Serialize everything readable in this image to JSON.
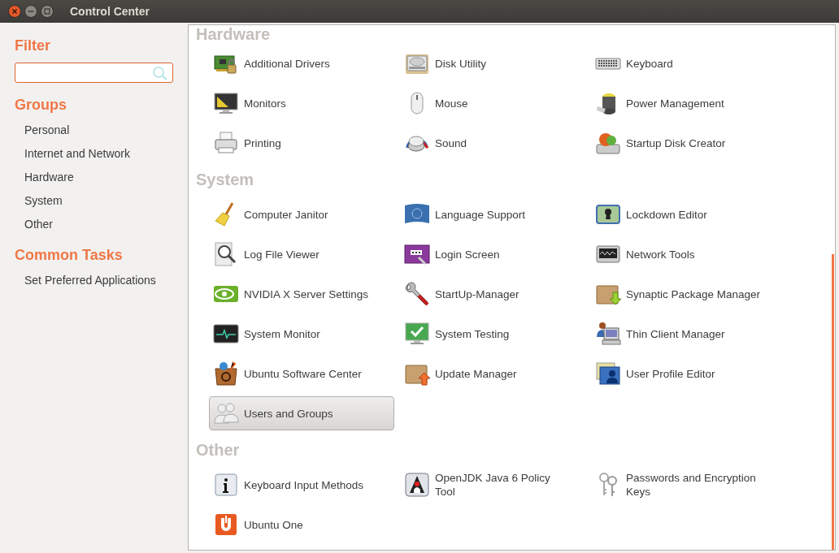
{
  "window": {
    "title": "Control Center"
  },
  "sidebar": {
    "sections": [
      {
        "kind": "search",
        "heading": "Filter"
      },
      {
        "kind": "links",
        "heading": "Groups",
        "items": [
          "Personal",
          "Internet and Network",
          "Hardware",
          "System",
          "Other"
        ]
      },
      {
        "kind": "links",
        "heading": "Common Tasks",
        "items": [
          "Set Preferred Applications"
        ]
      }
    ]
  },
  "content": {
    "sections": [
      {
        "heading": "Hardware",
        "items": [
          {
            "label": "Additional Drivers",
            "selected": false
          },
          {
            "label": "Disk Utility",
            "selected": false
          },
          {
            "label": "Keyboard",
            "selected": false
          },
          {
            "label": "Monitors",
            "selected": false
          },
          {
            "label": "Mouse",
            "selected": false
          },
          {
            "label": "Power Management",
            "selected": false
          },
          {
            "label": "Printing",
            "selected": false
          },
          {
            "label": "Sound",
            "selected": false
          },
          {
            "label": "Startup Disk Creator",
            "selected": false
          }
        ]
      },
      {
        "heading": "System",
        "items": [
          {
            "label": "Computer Janitor",
            "selected": false
          },
          {
            "label": "Language Support",
            "selected": false
          },
          {
            "label": "Lockdown Editor",
            "selected": false
          },
          {
            "label": "Log File Viewer",
            "selected": false
          },
          {
            "label": "Login Screen",
            "selected": false
          },
          {
            "label": "Network Tools",
            "selected": false
          },
          {
            "label": "NVIDIA X Server Settings",
            "selected": false
          },
          {
            "label": "StartUp-Manager",
            "selected": false
          },
          {
            "label": "Synaptic Package Manager",
            "selected": false
          },
          {
            "label": "System Monitor",
            "selected": false
          },
          {
            "label": "System Testing",
            "selected": false
          },
          {
            "label": "Thin Client Manager",
            "selected": false
          },
          {
            "label": "Ubuntu Software Center",
            "selected": false
          },
          {
            "label": "Update Manager",
            "selected": false
          },
          {
            "label": "User Profile Editor",
            "selected": false
          },
          {
            "label": "Users and Groups",
            "selected": true
          }
        ]
      },
      {
        "heading": "Other",
        "items": [
          {
            "label": "Keyboard Input Methods",
            "selected": false
          },
          {
            "label": "OpenJDK Java 6 Policy Tool",
            "selected": false
          },
          {
            "label": "Passwords and Encryption Keys",
            "selected": false
          },
          {
            "label": "Ubuntu One",
            "selected": false
          }
        ]
      }
    ]
  }
}
